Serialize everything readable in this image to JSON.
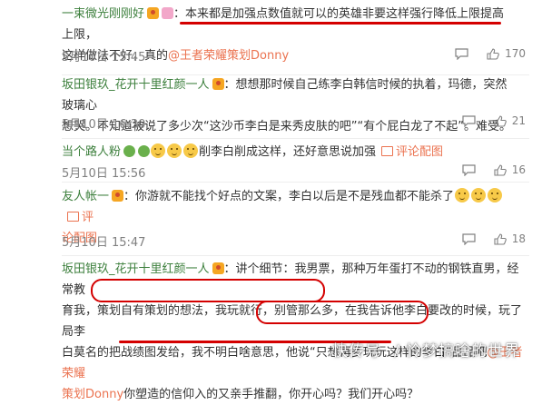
{
  "comments": [
    {
      "user": "一束微光刚刚好",
      "sep": "：",
      "text_a": "本来都是加强点数值就可以的英雄非要这样强行降低上限提高上限，",
      "text_b": "这样做法不好，真的",
      "mention": "@王者荣耀策划Donny",
      "time": "5月10日 15:45",
      "likes": "170"
    },
    {
      "user": "坂田银玖_花开十里红颜一人",
      "sep": "：",
      "text_a": "想想那时候自己练李白韩信时候的执着，玛德，突然玻璃心",
      "text_b": "想哭。不知道被说了多少次“这沙币李白是来秀皮肤的吧”“有个屁白龙了不起”。难受。",
      "time": "5月10日 16:30",
      "likes": "21"
    },
    {
      "user": "当个路人粉",
      "sep": "",
      "text_a": "削李白削成这样，还好意思说加强",
      "pic_label": "评论配图",
      "time": "5月10日 15:56",
      "likes": "16"
    },
    {
      "user": "友人帐一",
      "sep": "：",
      "text_a": "你游就不能找个好点的文案，李白以后是不是残血都不能杀了",
      "pic_label_a": "评",
      "pic_label_b": "论配图",
      "time": "5月10日 15:47",
      "likes": "18"
    },
    {
      "user": "坂田银玖_花开十里红颜一人",
      "sep": "：",
      "line1": "讲个细节：我男票，那种万年蛋打不动的钢铁直男，经常教",
      "line2_a": "育我，",
      "line2_b": "策划自有策划的想法，我玩就行，别管那么多",
      "line2_c": "，在我告诉他李白要改的时候，玩了局李",
      "line3_a": "白莫名的把战绩图发给，我不明白啥意思，",
      "line3_b": "他说“只想再多玩玩这样的李白”",
      "line3_c": "品品吧",
      "mention": "@王者荣耀",
      "line4_mention": "策划Donny",
      "line4_b": "你塑造的信仰入的又亲手推翻，你开心吗？我们开心吗？"
    }
  ],
  "watermark": {
    "left": "快传号",
    "right": "/ 怜梦搞啥的世界"
  },
  "colors": {
    "username": "#3c7f3c",
    "link": "#eb7350",
    "highlight": "#d40000"
  }
}
